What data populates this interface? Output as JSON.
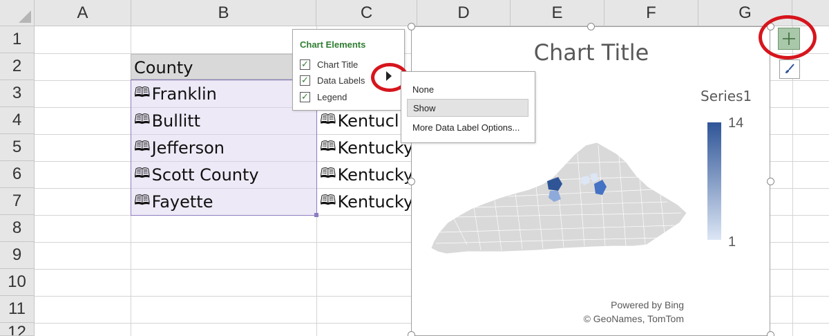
{
  "columns": [
    "A",
    "B",
    "C",
    "D",
    "E",
    "F",
    "G"
  ],
  "rows": [
    "1",
    "2",
    "3",
    "4",
    "5",
    "6",
    "7",
    "8",
    "9",
    "10",
    "11",
    "12"
  ],
  "cells": {
    "header": "County",
    "counties": [
      "Franklin",
      "Bullitt",
      "Jefferson",
      "Scott County",
      "Fayette"
    ],
    "states": [
      "",
      "Kentucl",
      "Kentucky",
      "Kentucky",
      "Kentucky"
    ],
    "map_glyph": "🕮"
  },
  "chart": {
    "title": "Chart Title",
    "legend_title": "Series1",
    "legend_max": "14",
    "legend_min": "1",
    "attribution_line1": "Powered by Bing",
    "attribution_line2": "© GeoNames, TomTom",
    "colors": {
      "high": "#2f5597",
      "mid": "#8eaadb",
      "low": "#dce6f5",
      "base": "#d9d9d9"
    }
  },
  "chart_elements_pane": {
    "title": "Chart Elements",
    "items": [
      {
        "label": "Chart Title",
        "checked": true
      },
      {
        "label": "Data Labels",
        "checked": true
      },
      {
        "label": "Legend",
        "checked": true
      }
    ]
  },
  "data_labels_submenu": {
    "items": [
      "None",
      "Show",
      "More Data Label Options..."
    ],
    "highlighted": "Show"
  },
  "side_buttons": {
    "elements_icon": "plus-icon",
    "styles_icon": "brush-icon"
  }
}
